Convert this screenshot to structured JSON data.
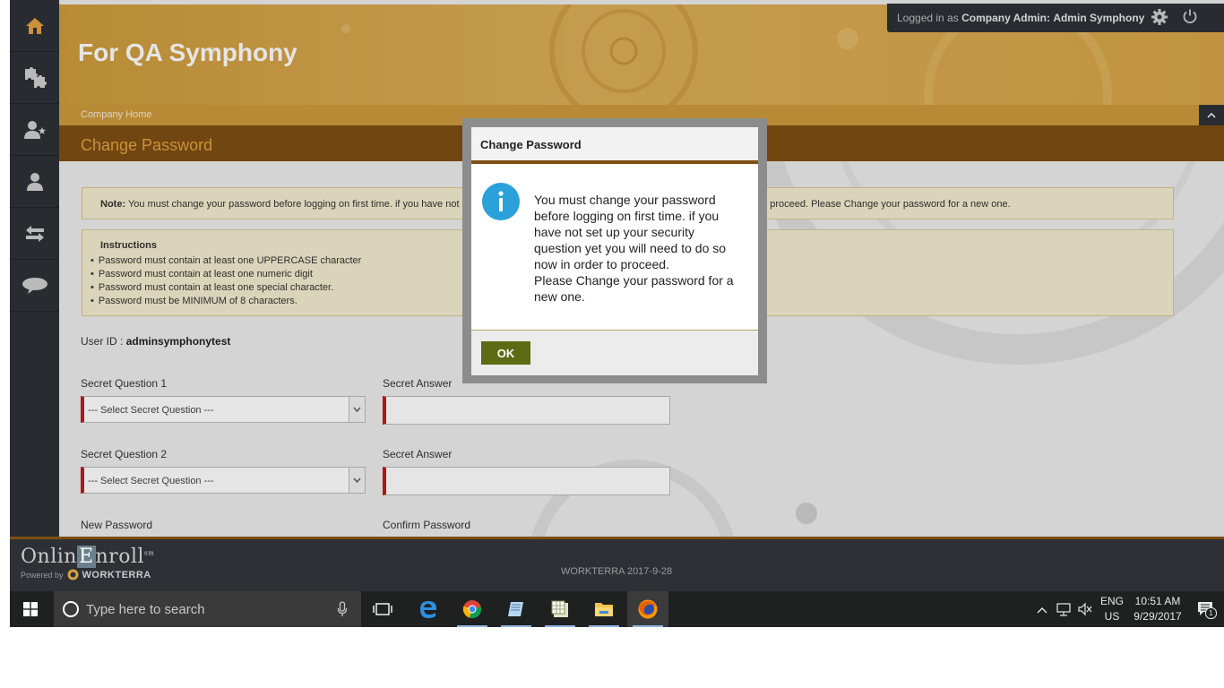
{
  "header": {
    "brand_title": "For QA Symphony",
    "user": {
      "prefix": "Logged in as",
      "role": "Company Admin:",
      "name": "Admin Symphony"
    }
  },
  "breadcrumb": "Company Home",
  "page_title": "Change Password",
  "note": {
    "label": "Note:",
    "text": "You must change your password before logging on first time. if you have not se",
    "text_tail": "to proceed. Please Change your password for a new one."
  },
  "instructions": {
    "heading": "Instructions",
    "items": [
      "Password must contain at least one UPPERCASE character",
      "Password must contain at least one numeric digit",
      "Password must contain at least one special character.",
      "Password must be MINIMUM of 8 characters."
    ]
  },
  "form": {
    "user_id_label": "User ID :",
    "user_id_value": "adminsymphonytest",
    "q1_label": "Secret Question 1",
    "q1_value": "--- Select Secret Question ---",
    "a1_label": "Secret Answer",
    "q2_label": "Secret Question 2",
    "q2_value": "--- Select Secret Question ---",
    "a2_label": "Secret Answer",
    "new_password_label": "New Password",
    "confirm_password_label": "Confirm Password"
  },
  "modal": {
    "title": "Change Password",
    "message_line1": "You must change your password before logging on first time. if you have not set up your security question yet you will need to do so now in order to proceed.",
    "message_line2": "Please Change your password for a new one.",
    "ok_label": "OK"
  },
  "footer": {
    "brand_main_a": "Onlin",
    "brand_main_e": "E",
    "brand_main_b": "nroll",
    "brand_tm": "sm",
    "powered_by": "Powered by",
    "powered_brand": "WORKTERRA",
    "version_text": "WORKTERRA 2017-9-28"
  },
  "taskbar": {
    "search_placeholder": "Type here to search",
    "lang_top": "ENG",
    "lang_bottom": "US",
    "time": "10:51 AM",
    "date": "9/29/2017",
    "notification_count": "1"
  },
  "colors": {
    "banner": "#d5a24a",
    "title_bar": "#7e4e13",
    "page_title_text": "#e1a341",
    "ok_button": "#5c6b14",
    "required_marker": "#c21a1a",
    "info_icon": "#2aa1d9"
  }
}
